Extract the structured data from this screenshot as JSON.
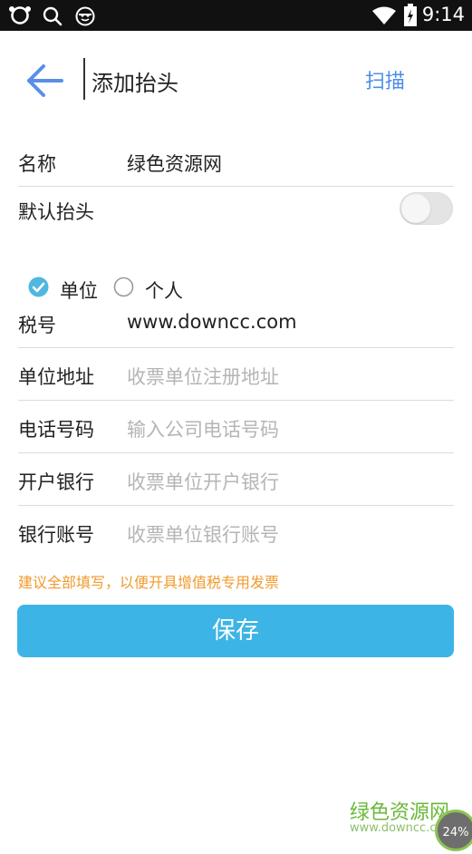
{
  "status_bar": {
    "time": "9:14",
    "icons": [
      "circle-app-icon",
      "search-icon",
      "face-icon",
      "wifi-icon",
      "battery-icon"
    ]
  },
  "header": {
    "back_icon": "arrow-left-icon",
    "title": "添加抬头",
    "scan_label": "扫描",
    "accent_color": "#4c8de6"
  },
  "form": {
    "name": {
      "label": "名称",
      "value": "绿色资源网"
    },
    "default_header": {
      "label": "默认抬头",
      "enabled": false
    },
    "type": {
      "options": [
        {
          "label": "单位",
          "selected": true
        },
        {
          "label": "个人",
          "selected": false
        }
      ]
    },
    "tax_no": {
      "label": "税号",
      "value": "www.downcc.com"
    },
    "address": {
      "label": "单位地址",
      "placeholder": "收票单位注册地址"
    },
    "phone": {
      "label": "电话号码",
      "placeholder": "输入公司电话号码"
    },
    "bank": {
      "label": "开户银行",
      "placeholder": "收票单位开户银行"
    },
    "account": {
      "label": "银行账号",
      "placeholder": "收票单位银行账号"
    }
  },
  "tip": "建议全部填写，以便开具增值税专用发票",
  "save_label": "保存",
  "save_color": "#3db4e6",
  "watermark": {
    "title": "绿色资源网",
    "url": "www.downcc.com",
    "percent": "24%"
  }
}
